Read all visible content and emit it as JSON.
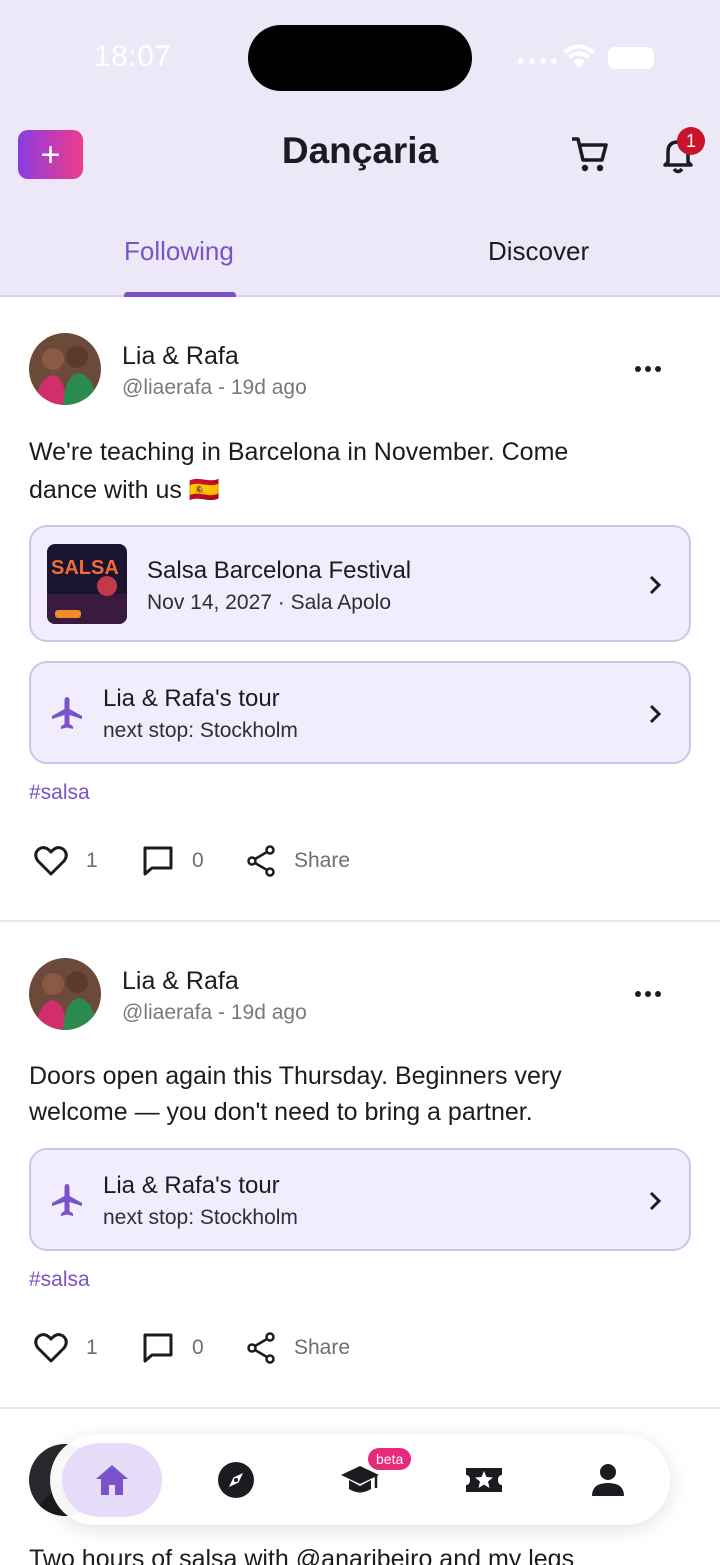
{
  "status_bar": {
    "time": "18:07"
  },
  "header": {
    "title": "Dançaria",
    "notification_count": "1",
    "plus_label": "+"
  },
  "tabs": [
    {
      "label": "Following"
    },
    {
      "label": "Discover"
    }
  ],
  "posts": [
    {
      "author": "Lia & Rafa",
      "meta": "@liaerafa - 19d ago",
      "text_line1": "We're teaching in Barcelona in November. Come",
      "text_line2": "dance with us 🇪🇸",
      "event": {
        "title": "Salsa Barcelona Festival",
        "subtitle": "Nov 14, 2027 · Sala Apolo",
        "poster_text": "SALSA"
      },
      "tour": {
        "title": "Lia & Rafa's tour",
        "subtitle": "next stop: Stockholm"
      },
      "hashtag": "#salsa",
      "likes": "1",
      "comments": "0",
      "share_label": "Share"
    },
    {
      "author": "Lia & Rafa",
      "meta": "@liaerafa - 19d ago",
      "text_line1": "Doors open again this Thursday. Beginners very",
      "text_line2": "welcome — you don't need to bring a partner.",
      "tour": {
        "title": "Lia & Rafa's tour",
        "subtitle": "next stop: Stockholm"
      },
      "hashtag": "#salsa",
      "likes": "1",
      "comments": "0",
      "share_label": "Share"
    }
  ],
  "peek_text": "Two hours of salsa with @anaribeiro and my legs",
  "bottom_nav": {
    "beta_label": "beta"
  },
  "colors": {
    "accent": "#7b52c9",
    "header_bg": "#ece8f8",
    "card_bg": "#f1edfc",
    "badge": "#c6142b",
    "beta": "#e72a7b"
  }
}
